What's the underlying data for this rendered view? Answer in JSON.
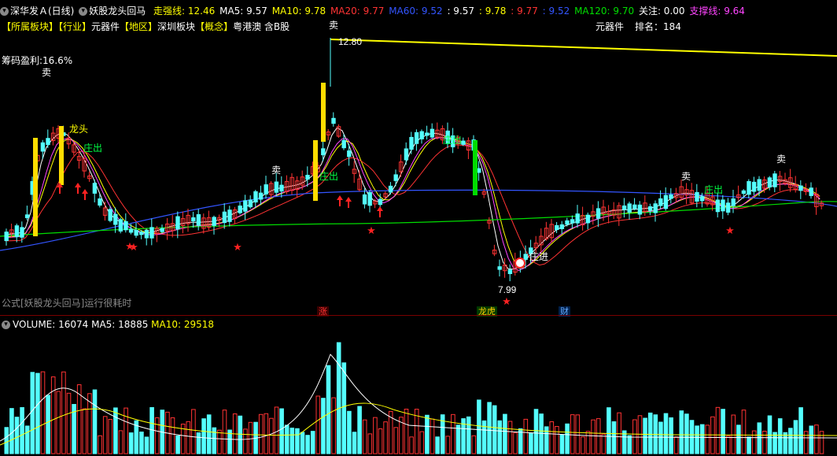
{
  "header": {
    "stock": "深华发Ａ(日线)",
    "formula_name": "妖股龙头回马",
    "indicators": [
      {
        "label": "走强线: 12.46",
        "color": "#ffff00"
      },
      {
        "label": "MA5: 9.57",
        "color": "#ffffff"
      },
      {
        "label": "MA10: 9.78",
        "color": "#ffff00"
      },
      {
        "label": "MA20: 9.77",
        "color": "#ff3333"
      },
      {
        "label": "MA60: 9.52",
        "color": "#3355ff"
      },
      {
        "label": ": 9.57",
        "color": "#ffffff"
      },
      {
        "label": ": 9.78",
        "color": "#ffff00"
      },
      {
        "label": ": 9.77",
        "color": "#ff3333"
      },
      {
        "label": ": 9.52",
        "color": "#3355ff"
      },
      {
        "label": "MA120: 9.70",
        "color": "#00dd00"
      },
      {
        "label": "关注: 0.00",
        "color": "#ffffff"
      },
      {
        "label": "支撑线: 9.64",
        "color": "#ff44ff"
      }
    ]
  },
  "tags": {
    "industry_prefix": "【所属板块】【行业】",
    "industry": "元器件",
    "region_prefix": "【地区】",
    "region": "深圳板块",
    "concept_prefix": "【概念】",
    "concept": "粤港澳 含B股"
  },
  "sector_rank": {
    "sector": "元器件",
    "rank_label": "排名：",
    "rank_value": "184"
  },
  "chip_profit": "筹码盈利:16.6%",
  "formula_note": "公式[妖股龙头回马]运行很耗时",
  "annotations": {
    "sell": "卖",
    "dragon": "龙头",
    "dealer_out": "庄出",
    "dealer_in": "庄进",
    "high_price": "12.80",
    "low_price": "7.99"
  },
  "event_markers": [
    {
      "label": "涨",
      "color": "#ff3333"
    },
    {
      "label": "龙虎",
      "color": "#ffcc00"
    },
    {
      "label": "财",
      "color": "#66aaff"
    }
  ],
  "volume": {
    "label": "VOLUME: 16074",
    "ma5": "MA5: 18885",
    "ma10": "MA10: 29518"
  },
  "colors": {
    "up": "#ff3333",
    "down": "#54ffff",
    "ma5": "#ffffff",
    "ma10": "#ffff00",
    "ma20": "#ff3333",
    "ma60": "#3355ff",
    "ma120": "#00dd00",
    "support": "#ff44ff"
  }
}
